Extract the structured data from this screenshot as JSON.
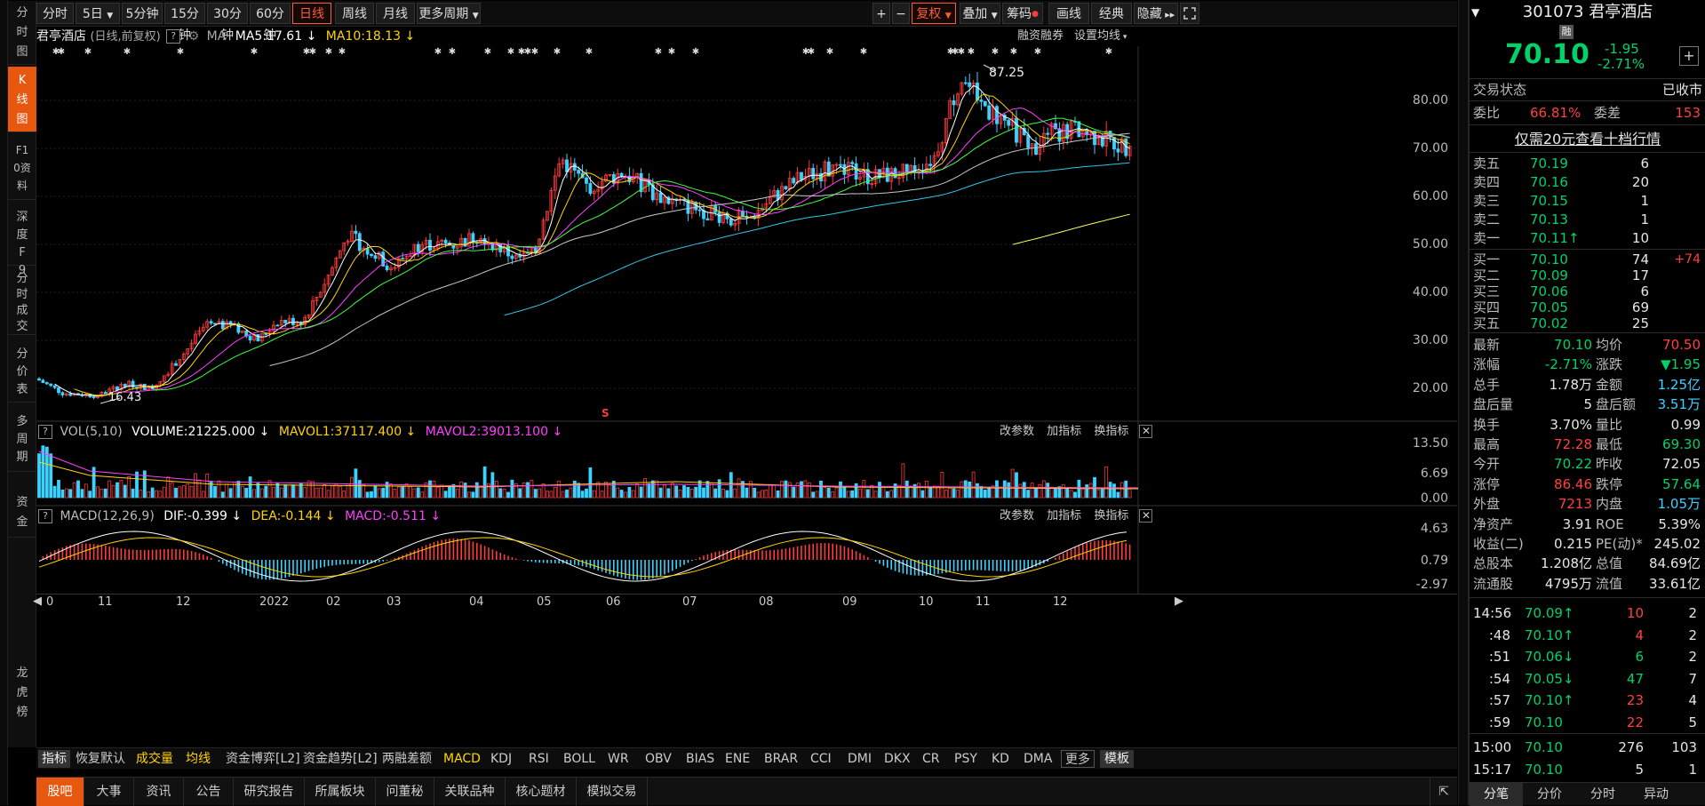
{
  "toolbar": {
    "periods": [
      "分时",
      "5日",
      "5分钟",
      "15分钟",
      "30分钟",
      "60分钟",
      "日线",
      "周线",
      "月线",
      "更多周期"
    ],
    "active_period": "日线",
    "right": [
      "+",
      "−",
      "复权",
      "叠加",
      "筹码",
      "画线",
      "经典",
      "隐藏"
    ]
  },
  "leftnav": [
    "分时图",
    "K线图",
    "F10资料",
    "深度F9",
    "分时成交",
    "分价表",
    "多周期",
    "资金",
    "龙虎榜"
  ],
  "chart_header": {
    "stock": "君亭酒店",
    "mode": "(日线,前复权)",
    "ma_label": "MA",
    "ma5": "MA5:17.61",
    "ma10": "MA10:18.13",
    "right1": "融资融券",
    "right2": "设置均线"
  },
  "annotations": {
    "high": "87.25",
    "low": "16.43",
    "marker": "S"
  },
  "vol_header": {
    "label": "VOL(5,10)",
    "volume": "VOLUME:21225.000",
    "mavol1": "MAVOL1:37117.400",
    "mavol2": "MAVOL2:39013.100",
    "tools": [
      "改参数",
      "加指标",
      "换指标"
    ]
  },
  "macd_header": {
    "label": "MACD(12,26,9)",
    "dif": "DIF:-0.399",
    "dea": "DEA:-0.144",
    "macd": "MACD:-0.511",
    "tools": [
      "改参数",
      "加指标",
      "换指标"
    ]
  },
  "x_axis": [
    "0",
    "11",
    "12",
    "2022",
    "02",
    "03",
    "04",
    "05",
    "06",
    "07",
    "08",
    "09",
    "10",
    "11",
    "12"
  ],
  "indicator_bar": [
    "指标",
    "恢复默认",
    "成交量",
    "均线",
    "资金博弈[L2]",
    "资金趋势[L2]",
    "两融差额",
    "MACD",
    "KDJ",
    "RSI",
    "BOLL",
    "WR",
    "OBV",
    "BIAS",
    "ENE",
    "BRAR",
    "CCI",
    "DMI",
    "DKX",
    "CR",
    "PSY",
    "KD",
    "DMA",
    "更多",
    "模板"
  ],
  "bottom_tabs": [
    "股吧",
    "大事",
    "资讯",
    "公告",
    "研究报告",
    "所属板块",
    "问董秘",
    "关联品种",
    "核心题材",
    "模拟交易"
  ],
  "quote": {
    "code": "301073",
    "name": "君亭酒店",
    "badge": "融",
    "price": "70.10",
    "change": "-1.95",
    "change_pct": "-2.71%",
    "status_label": "交易状态",
    "status": "已收市",
    "weibi_label": "委比",
    "weibi": "66.81%",
    "weicha_label": "委差",
    "weicha": "153",
    "promo": "仅需20元查看十档行情",
    "sells": [
      {
        "label": "卖五",
        "price": "70.19",
        "vol": "6"
      },
      {
        "label": "卖四",
        "price": "70.16",
        "vol": "20"
      },
      {
        "label": "卖三",
        "price": "70.15",
        "vol": "1"
      },
      {
        "label": "卖二",
        "price": "70.13",
        "vol": "1"
      },
      {
        "label": "卖一",
        "price": "70.11↑",
        "vol": "10"
      }
    ],
    "buys": [
      {
        "label": "买一",
        "price": "70.10",
        "vol": "74",
        "extra": "+74"
      },
      {
        "label": "买二",
        "price": "70.09",
        "vol": "17",
        "extra": ""
      },
      {
        "label": "买三",
        "price": "70.06",
        "vol": "6",
        "extra": ""
      },
      {
        "label": "买四",
        "price": "70.05",
        "vol": "69",
        "extra": ""
      },
      {
        "label": "买五",
        "price": "70.02",
        "vol": "25",
        "extra": ""
      }
    ],
    "stats": [
      [
        "最新",
        "70.10",
        "均价",
        "70.50"
      ],
      [
        "涨幅",
        "-2.71%",
        "涨跌",
        "▼1.95"
      ],
      [
        "总手",
        "1.78万",
        "金额",
        "1.25亿"
      ],
      [
        "盘后量",
        "5",
        "盘后额",
        "3.51万"
      ],
      [
        "换手",
        "3.70%",
        "量比",
        "0.99"
      ],
      [
        "最高",
        "72.28",
        "最低",
        "69.30"
      ],
      [
        "今开",
        "70.22",
        "昨收",
        "72.05"
      ],
      [
        "涨停",
        "86.46",
        "跌停",
        "57.64"
      ],
      [
        "外盘",
        "7213",
        "内盘",
        "1.05万"
      ],
      [
        "净资产",
        "3.91",
        "ROE",
        "5.39%"
      ],
      [
        "收益(二)",
        "0.215",
        "PE(动)*",
        "245.02"
      ],
      [
        "总股本",
        "1.208亿",
        "总值",
        "84.69亿"
      ],
      [
        "流通股",
        "4795万",
        "流值",
        "33.61亿"
      ]
    ],
    "ticks": [
      [
        "14:56",
        "70.09↑",
        "10",
        "2"
      ],
      [
        ":48",
        "70.10↑",
        "4",
        "2"
      ],
      [
        ":51",
        "70.06↓",
        "6",
        "2"
      ],
      [
        ":54",
        "70.05↓",
        "47",
        "7"
      ],
      [
        ":57",
        "70.10↑",
        "23",
        "4"
      ],
      [
        ":59",
        "70.10",
        "22",
        "5"
      ],
      [
        "15:00",
        "70.10",
        "276",
        "103"
      ],
      [
        "15:17",
        "70.10",
        "5",
        "1"
      ]
    ],
    "tabs": [
      "分笔",
      "分价",
      "分时",
      "异动"
    ]
  },
  "chart_data": {
    "type": "candlestick",
    "price_axis": [
      "80.00",
      "70.00",
      "60.00",
      "50.00",
      "40.00",
      "30.00",
      "20.00"
    ],
    "vol_axis": [
      "13.50",
      "6.69",
      "0.00"
    ],
    "macd_axis": [
      "4.63",
      "0.79",
      "-2.97"
    ],
    "high_label": "87.25",
    "low_label": "16.43"
  },
  "colors": {
    "up": "#ff3b3b",
    "down": "#3cd2ff",
    "ma5": "#ffffff",
    "ma10": "#ffd400",
    "ma20": "#ff40ff",
    "ma30": "#40ff40",
    "ma60": "#c8c8c8",
    "ma120": "#30c8e6",
    "ma250": "#ffff66",
    "accent": "#e8570f"
  }
}
